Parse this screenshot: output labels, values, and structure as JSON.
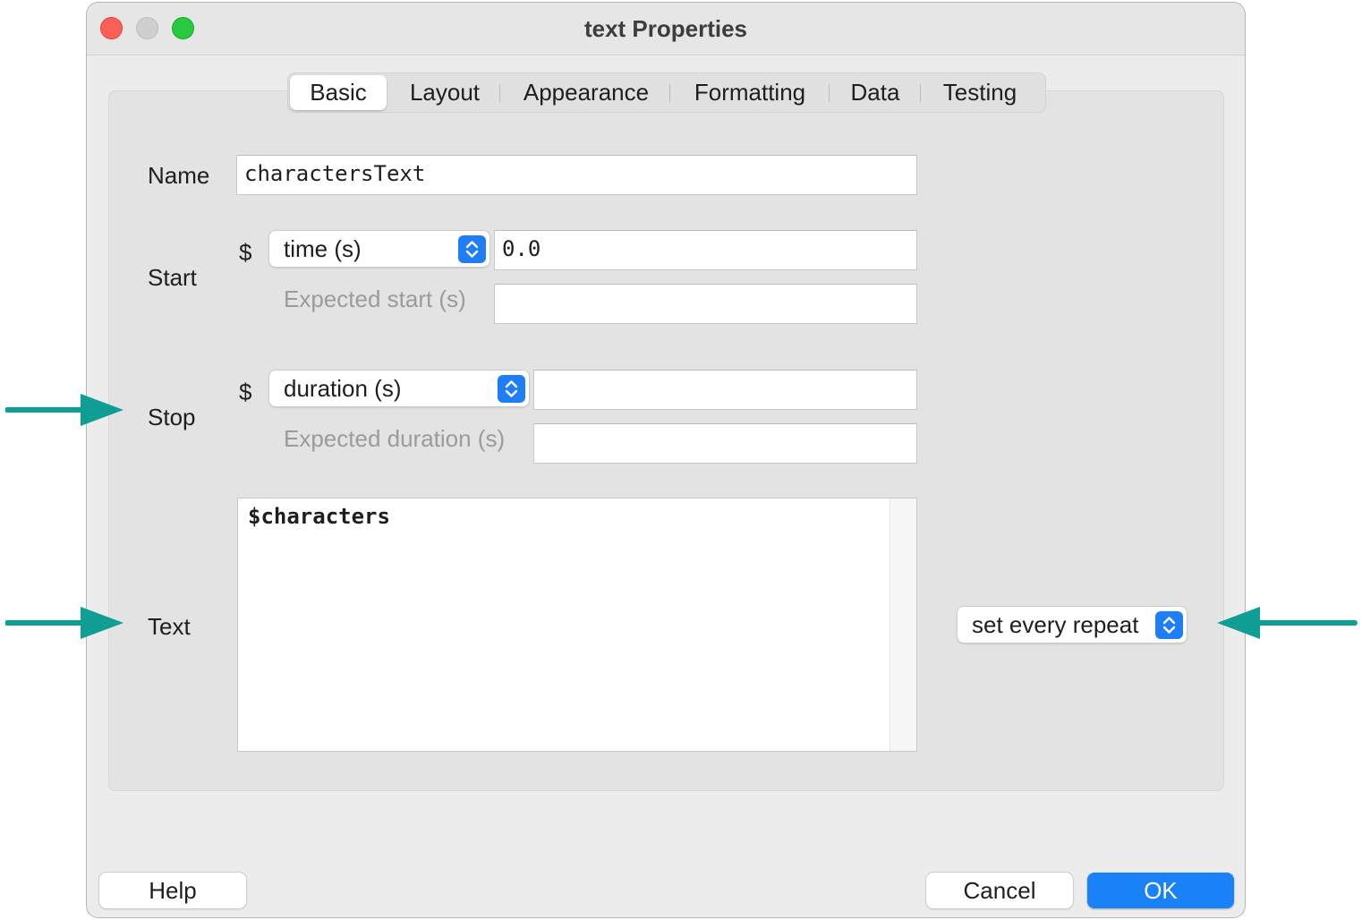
{
  "window": {
    "title": "text Properties"
  },
  "tabs": [
    {
      "label": "Basic",
      "active": true
    },
    {
      "label": "Layout",
      "active": false
    },
    {
      "label": "Appearance",
      "active": false
    },
    {
      "label": "Formatting",
      "active": false
    },
    {
      "label": "Data",
      "active": false
    },
    {
      "label": "Testing",
      "active": false
    }
  ],
  "form": {
    "name": {
      "label": "Name",
      "value": "charactersText"
    },
    "start": {
      "label": "Start",
      "dollar": "$",
      "type_selected": "time (s)",
      "value": "0.0",
      "expected_label": "Expected start (s)",
      "expected_value": ""
    },
    "stop": {
      "label": "Stop",
      "dollar": "$",
      "type_selected": "duration (s)",
      "value": "",
      "expected_label": "Expected duration (s)",
      "expected_value": ""
    },
    "text": {
      "label": "Text",
      "value": "$characters",
      "update_selected": "set every repeat"
    }
  },
  "buttons": {
    "help": "Help",
    "cancel": "Cancel",
    "ok": "OK"
  },
  "colors": {
    "accent": "#1a82f7",
    "annotation_arrow": "#0e9e94"
  }
}
